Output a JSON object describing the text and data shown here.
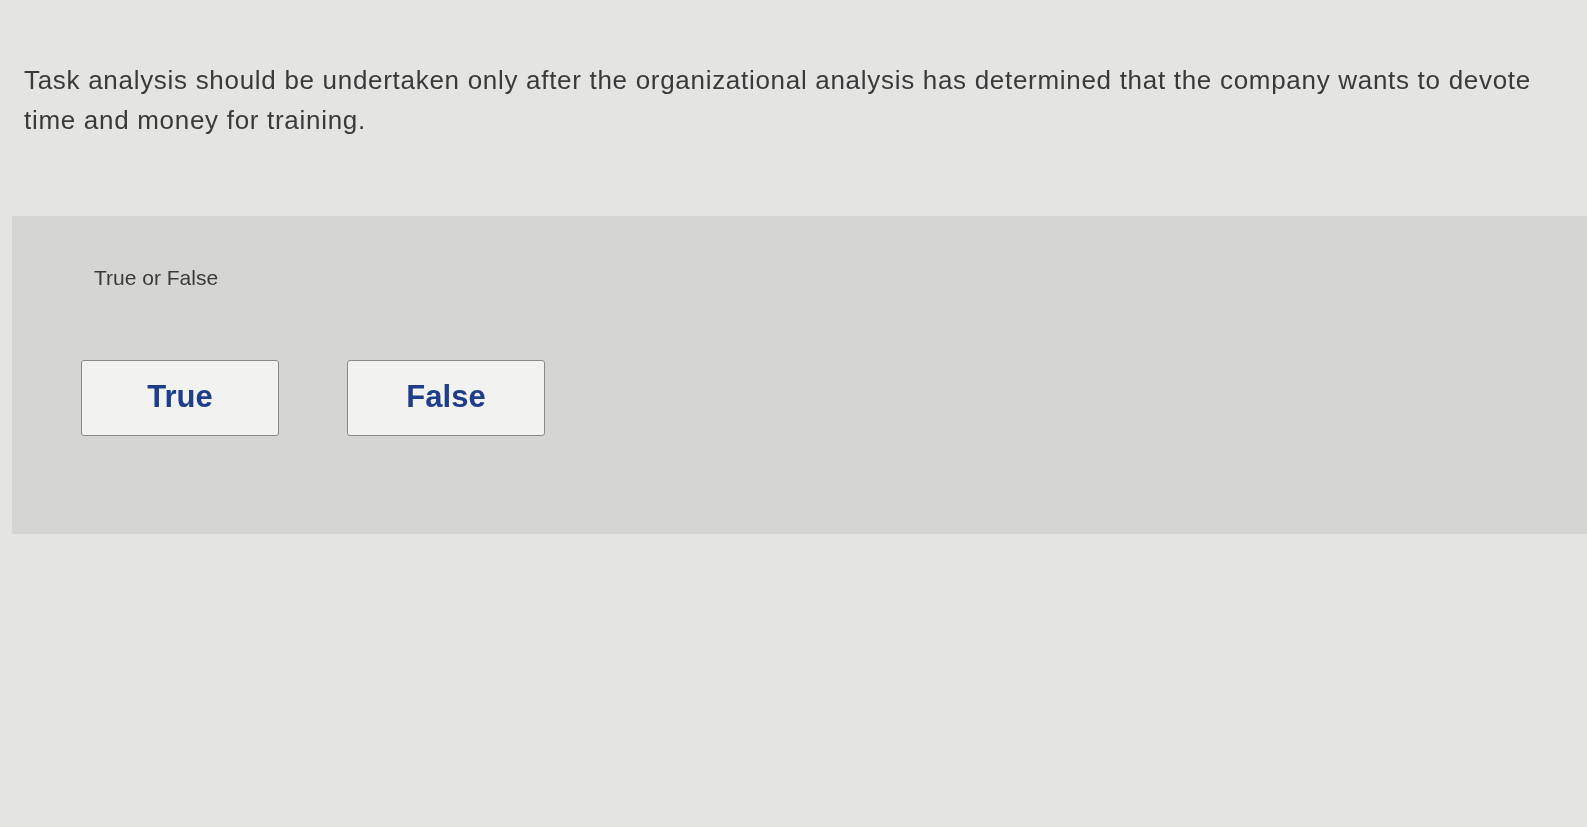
{
  "question": {
    "text": "Task analysis should be undertaken only after the organizational analysis has determined that the company wants to devote time and money for training."
  },
  "answer_panel": {
    "prompt": "True or False",
    "options": [
      {
        "label": "True",
        "selected": false
      },
      {
        "label": "False",
        "selected": false
      }
    ]
  }
}
